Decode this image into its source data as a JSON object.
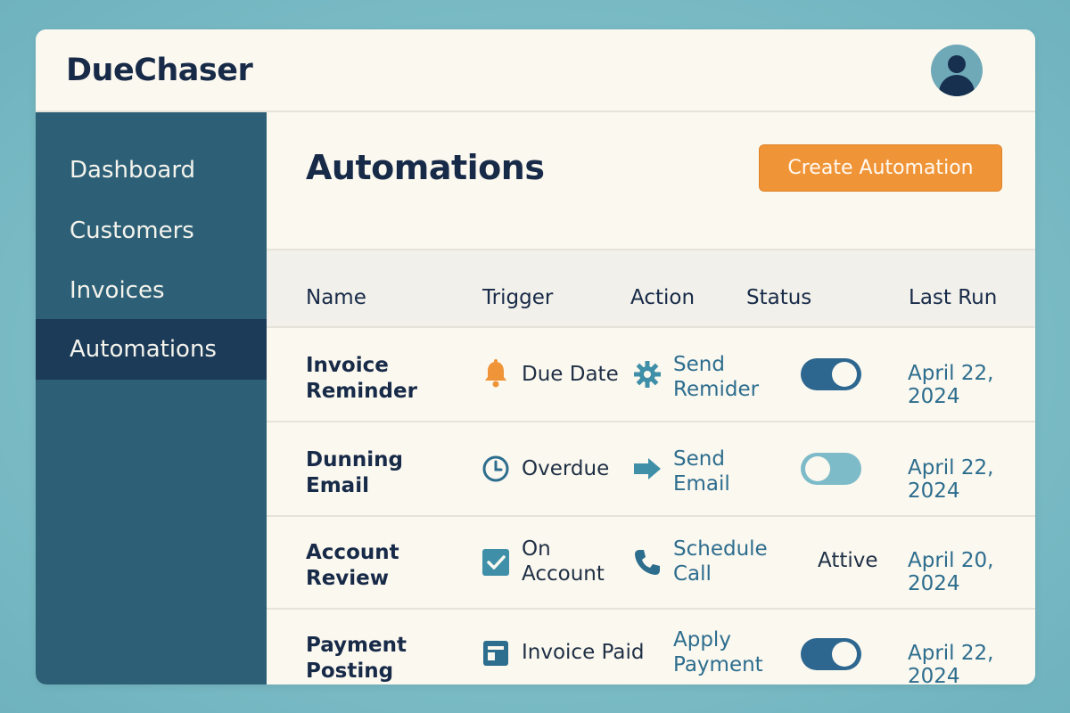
{
  "app": {
    "title": "DueChaser"
  },
  "sidebar": {
    "items": [
      {
        "label": "Dashboard",
        "active": false
      },
      {
        "label": "Customers",
        "active": false
      },
      {
        "label": "Invoices",
        "active": false
      },
      {
        "label": "Automations",
        "active": true
      }
    ]
  },
  "main": {
    "title": "Automations",
    "create_button": "Create Automation"
  },
  "table": {
    "headers": {
      "name": "Name",
      "trigger": "Trigger",
      "action": "Action",
      "status": "Status",
      "last_run": "Last Run"
    },
    "rows": [
      {
        "name": "Invoice\nReminder",
        "trigger": "Due Date",
        "trigger_icon": "bell-icon",
        "action": "Send\nRemider",
        "action_icon": "gear-icon",
        "status": "on",
        "last_run": "April 22, 2024"
      },
      {
        "name": "Dunning\nEmail",
        "trigger": "Overdue",
        "trigger_icon": "clock-icon",
        "action": "Send\nEmail",
        "action_icon": "arrow-right-icon",
        "status": "off",
        "last_run": "April 22, 2024"
      },
      {
        "name": "Account\nReview",
        "trigger": "On\nAccount",
        "trigger_icon": "checkbox-icon",
        "action": "Schedule\nCall",
        "action_icon": "phone-icon",
        "status": "Attive",
        "last_run": "April 20, 2024"
      },
      {
        "name": "Payment\nPosting",
        "trigger": "Invoice Paid",
        "trigger_icon": "invoice-icon",
        "action": "Apply\nPayment",
        "action_icon": null,
        "status": "on",
        "last_run": "April 22, 2024"
      }
    ]
  },
  "colors": {
    "accent": "#f09438",
    "sidebar": "#2d6077",
    "sidebar_active": "#1b3b59",
    "toggle_on": "#2d6790",
    "toggle_off": "#7dbbc9",
    "link": "#2d6d8e"
  }
}
